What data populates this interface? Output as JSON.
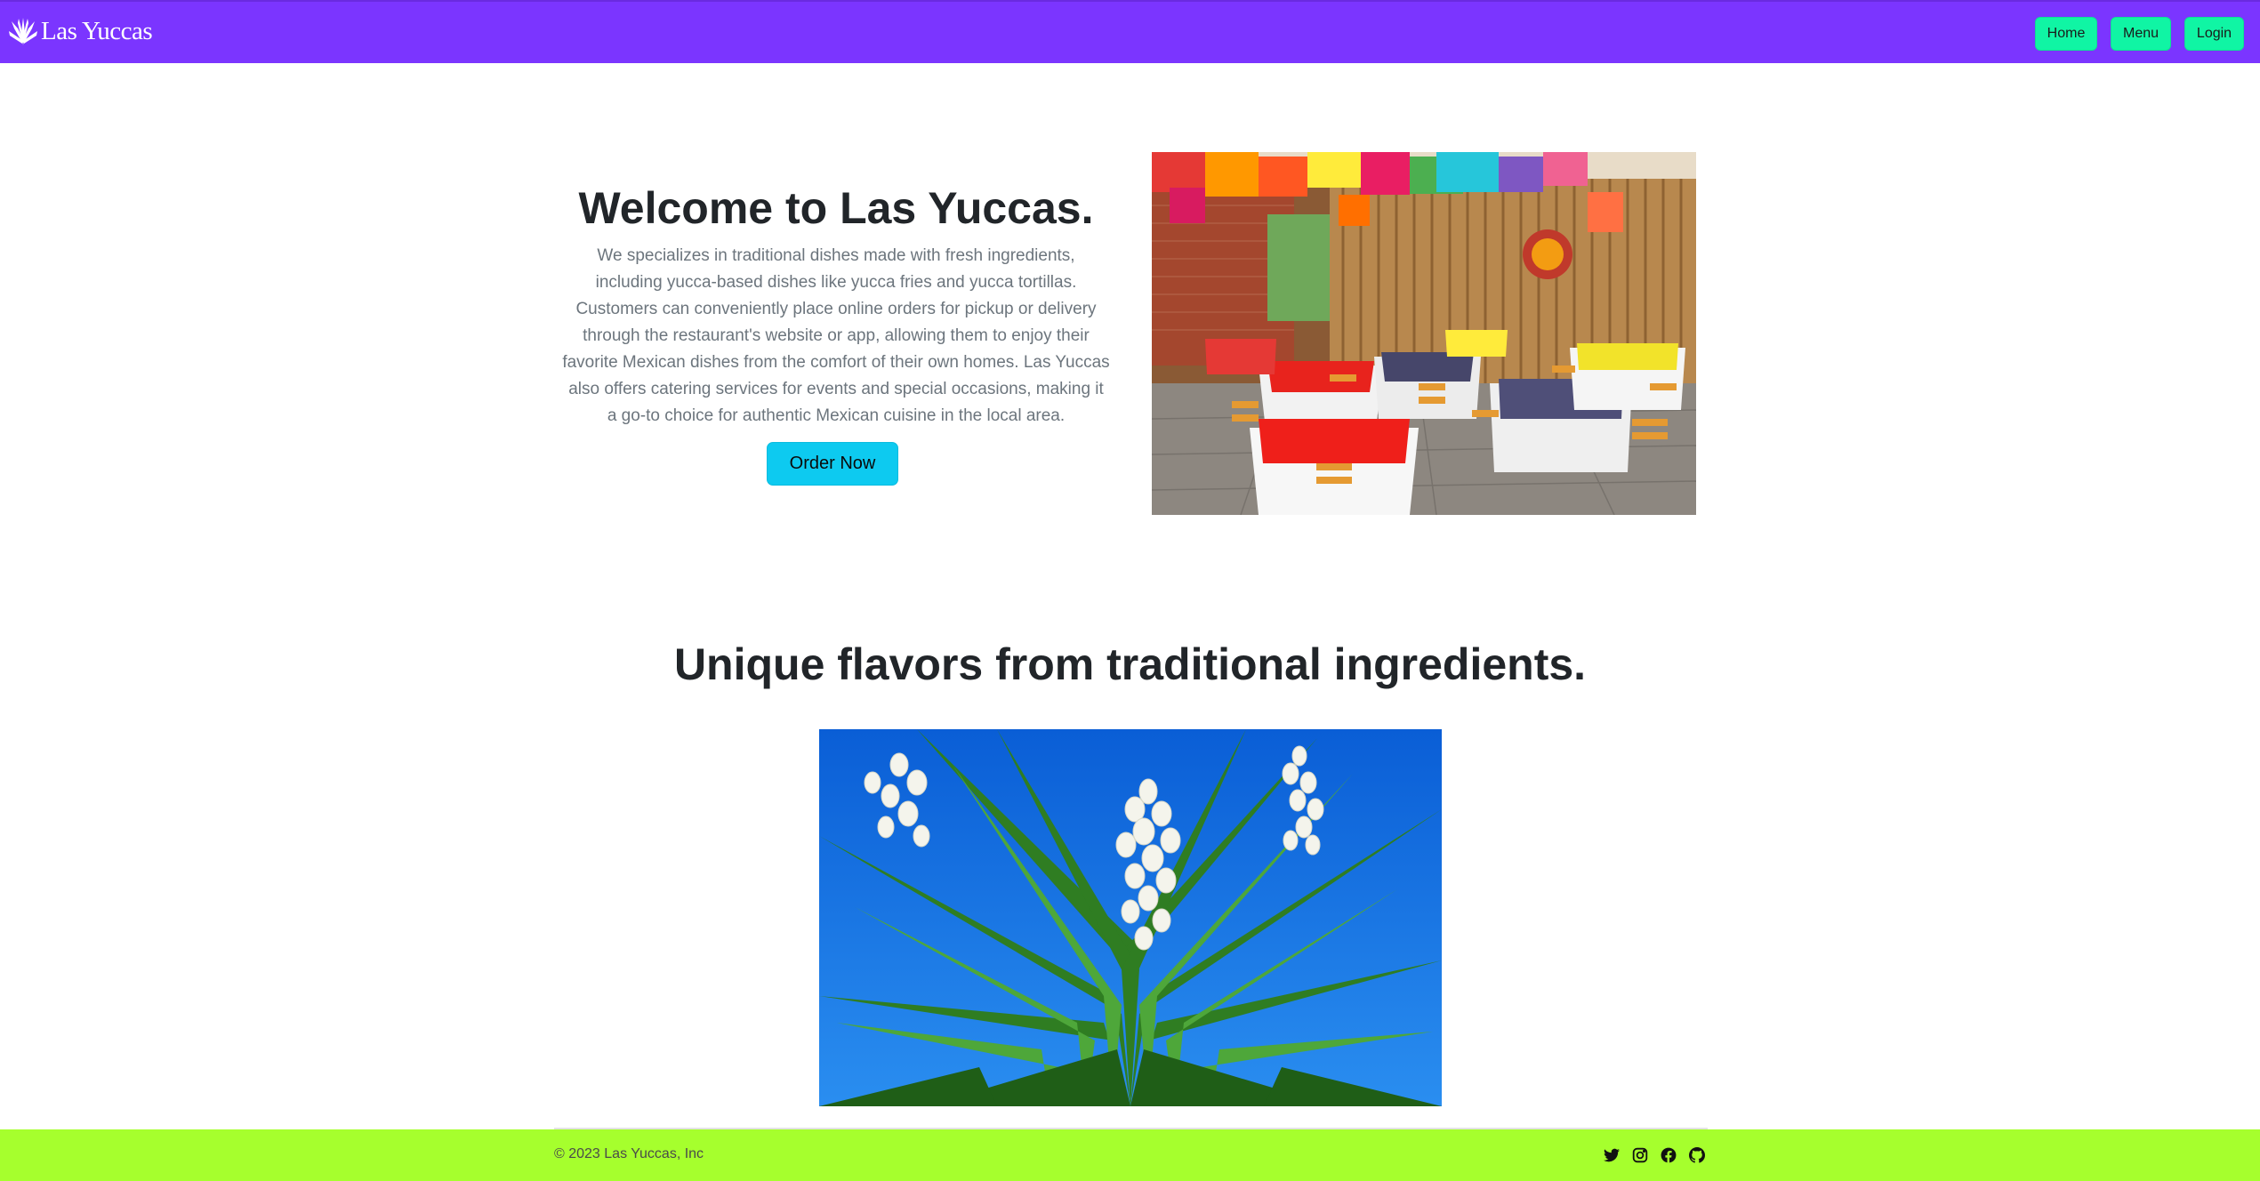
{
  "navbar": {
    "brand_name": "Las Yuccas",
    "brand_icon": "yucca-plant-icon",
    "buttons": {
      "home": "Home",
      "menu": "Menu",
      "login": "Login"
    },
    "colors": {
      "background": "#7b35ff",
      "button": "#10f5a4"
    }
  },
  "hero": {
    "title": "Welcome to Las Yuccas.",
    "description": "We specializes in traditional dishes made with fresh ingredients, including yucca-based dishes like yucca fries and yucca tortillas. Customers can conveniently place online orders for pickup or delivery through the restaurant's website or app, allowing them to enjoy their favorite Mexican dishes from the comfort of their own homes. Las Yuccas also offers catering services for events and special occasions, making it a go-to choice for authentic Mexican cuisine in the local area.",
    "order_button": "Order Now",
    "order_button_color": "#0dcaf0"
  },
  "section": {
    "title": "Unique flavors from traditional ingredients."
  },
  "footer": {
    "copyright": "© 2023 Las Yuccas, Inc",
    "background": "#a6ff2d",
    "social_icons": [
      "twitter-icon",
      "instagram-icon",
      "facebook-icon",
      "github-icon"
    ]
  }
}
